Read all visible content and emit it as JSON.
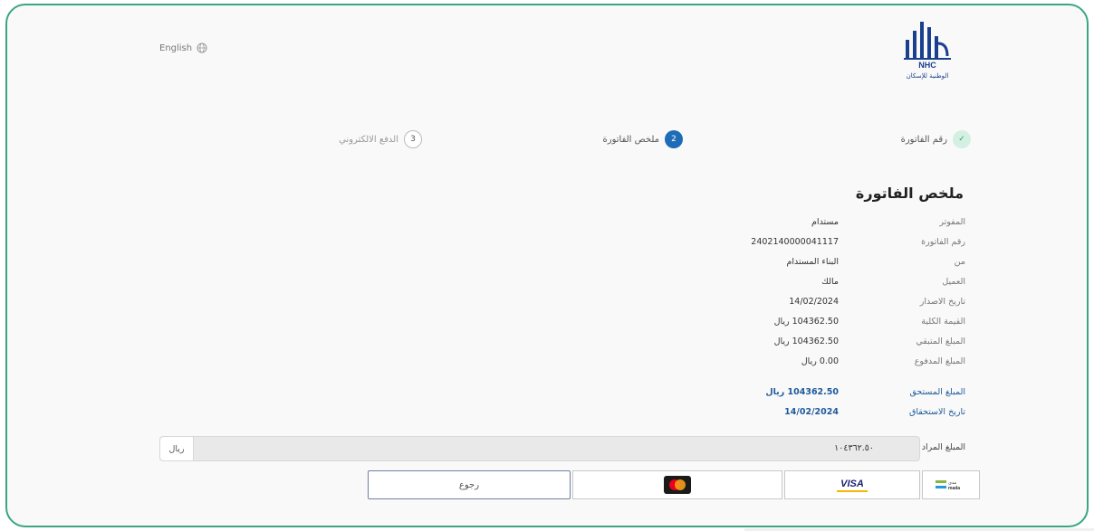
{
  "header": {
    "language_label": "English",
    "brand": {
      "logo_latin": "NHC",
      "logo_arabic": "الوطنية للإسكان"
    }
  },
  "steps": [
    {
      "number": "1",
      "label": "رقم الفاتورة",
      "status": "done"
    },
    {
      "number": "2",
      "label": "ملخص الفاتورة",
      "status": "active"
    },
    {
      "number": "3",
      "label": "الدفع الالكتروني",
      "status": "todo"
    }
  ],
  "summary": {
    "title": "ملخص الفاتورة",
    "rows": [
      {
        "label": "المفوتر",
        "value": "مستدام"
      },
      {
        "label": "رقم الفاتورة",
        "value": "2402140000041117"
      },
      {
        "label": "من",
        "value": "البناء المستدام"
      },
      {
        "label": "العميل",
        "value": "مالك"
      },
      {
        "label": "تاريخ الاصدار",
        "value": "14/02/2024"
      },
      {
        "label": "القيمة الكلية",
        "value": "104362.50 ريال"
      },
      {
        "label": "المبلغ المتبقي",
        "value": "104362.50 ريال"
      },
      {
        "label": "المبلغ المدفوع",
        "value": "0.00 ريال"
      },
      {
        "label": "المبلغ المستحق",
        "value": "104362.50 ريال"
      },
      {
        "label": "تاريخ الاستحقاق",
        "value": "14/02/2024"
      }
    ]
  },
  "payment": {
    "amount_label": "المبلغ المراد دفعه",
    "amount_value": "١٠٤٣٦٢.٥٠",
    "currency": "ريال",
    "back_label": "رجوع",
    "methods": [
      {
        "name": "mada",
        "label": "mada",
        "label_ar": "مدى"
      },
      {
        "name": "visa",
        "label": "VISA"
      },
      {
        "name": "mastercard",
        "label": "MasterCard"
      }
    ]
  },
  "colors": {
    "frame": "#3aa682",
    "primary": "#1e6bb8",
    "due": "#1e5a9a"
  }
}
